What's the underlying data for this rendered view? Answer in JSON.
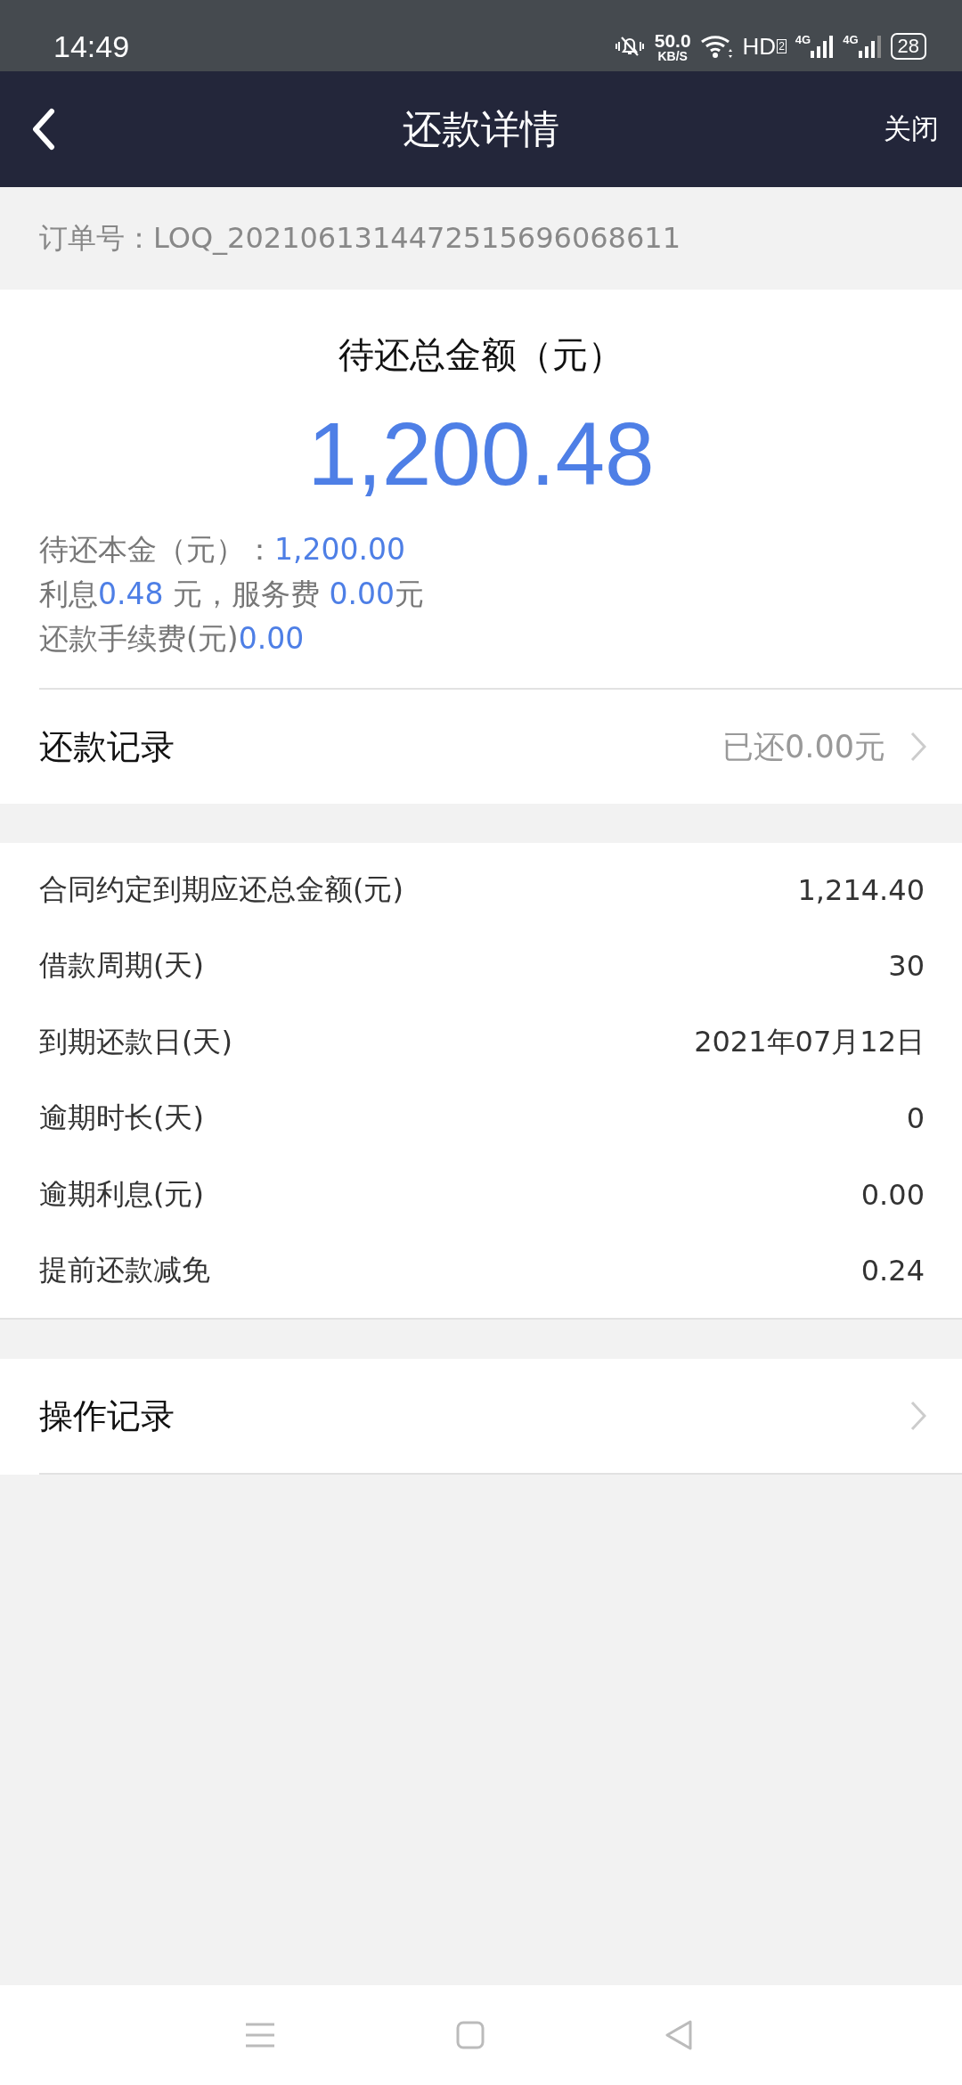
{
  "status_bar": {
    "time": "14:49",
    "speed": "50.0",
    "speed_unit": "KB/S",
    "hd": "HD",
    "hd_sim": "2",
    "networks": [
      "4G",
      "4G"
    ],
    "battery": "28"
  },
  "nav": {
    "title": "还款详情",
    "close": "关闭"
  },
  "order": {
    "label": "订单号：LOQ_2021061314472515696068611"
  },
  "summary": {
    "title": "待还总金额（元）",
    "amount": "1,200.48",
    "lines": [
      [
        {
          "kind": "label",
          "text": "待还本金（元）："
        },
        {
          "kind": "value",
          "text": "1,200.00"
        }
      ],
      [
        {
          "kind": "label",
          "text": "利息"
        },
        {
          "kind": "value",
          "text": "0.48"
        },
        {
          "kind": "label",
          "text": " 元，服务费 "
        },
        {
          "kind": "value",
          "text": "0.00"
        },
        {
          "kind": "label",
          "text": "元"
        }
      ],
      [
        {
          "kind": "label",
          "text": "还款手续费(元)"
        },
        {
          "kind": "value",
          "text": "0.00"
        }
      ]
    ]
  },
  "repay_record": {
    "label": "还款记录",
    "value": "已还0.00元"
  },
  "details": [
    {
      "label": "合同约定到期应还总金额(元)",
      "value": "1,214.40"
    },
    {
      "label": "借款周期(天)",
      "value": "30"
    },
    {
      "label": "到期还款日(天)",
      "value": "2021年07月12日"
    },
    {
      "label": "逾期时长(天)",
      "value": "0"
    },
    {
      "label": "逾期利息(元)",
      "value": "0.00"
    },
    {
      "label": "提前还款减免",
      "value": "0.24"
    }
  ],
  "op_record": {
    "label": "操作记录"
  }
}
